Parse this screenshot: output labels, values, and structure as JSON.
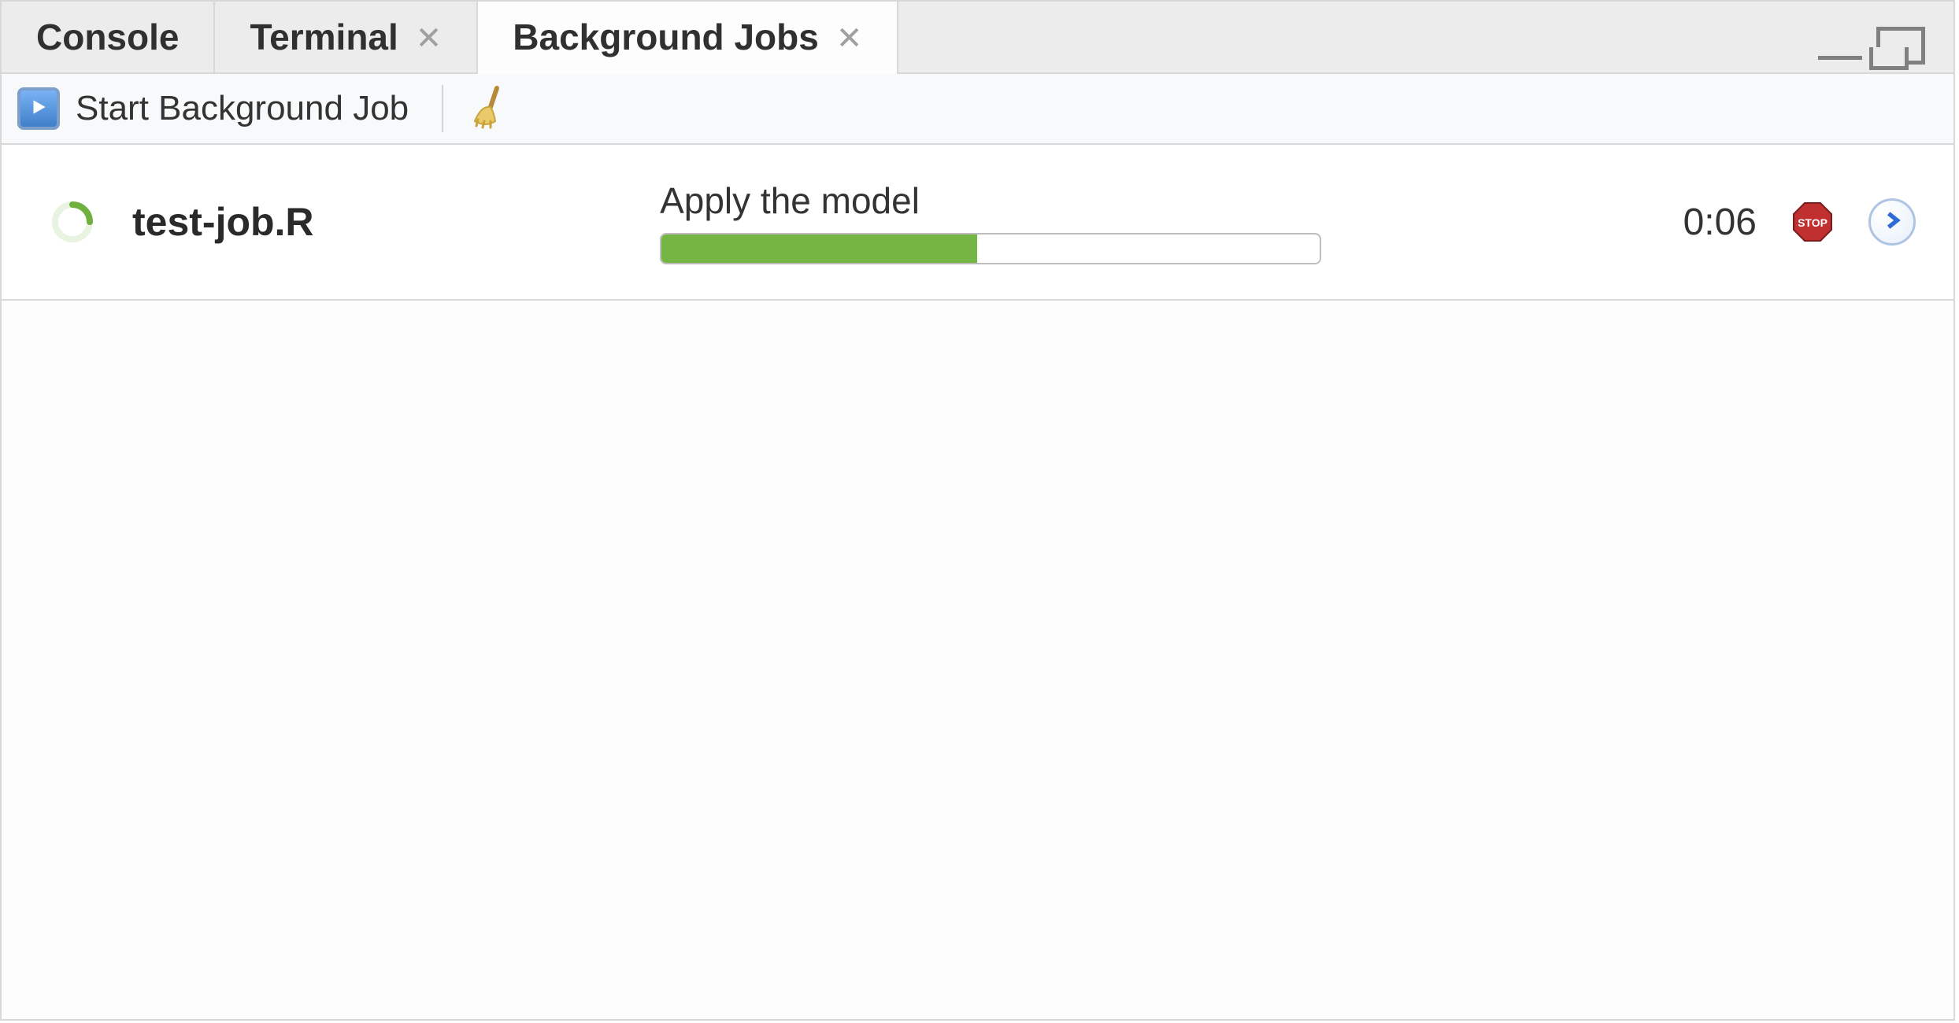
{
  "tabs": {
    "console": {
      "label": "Console",
      "closable": false,
      "active": false
    },
    "terminal": {
      "label": "Terminal",
      "closable": true,
      "active": false
    },
    "bgjobs": {
      "label": "Background Jobs",
      "closable": true,
      "active": true
    }
  },
  "toolbar": {
    "start_label": "Start Background Job"
  },
  "jobs": [
    {
      "name": "test-job.R",
      "status_text": "Apply the model",
      "progress_percent": 48,
      "elapsed": "0:06"
    }
  ]
}
